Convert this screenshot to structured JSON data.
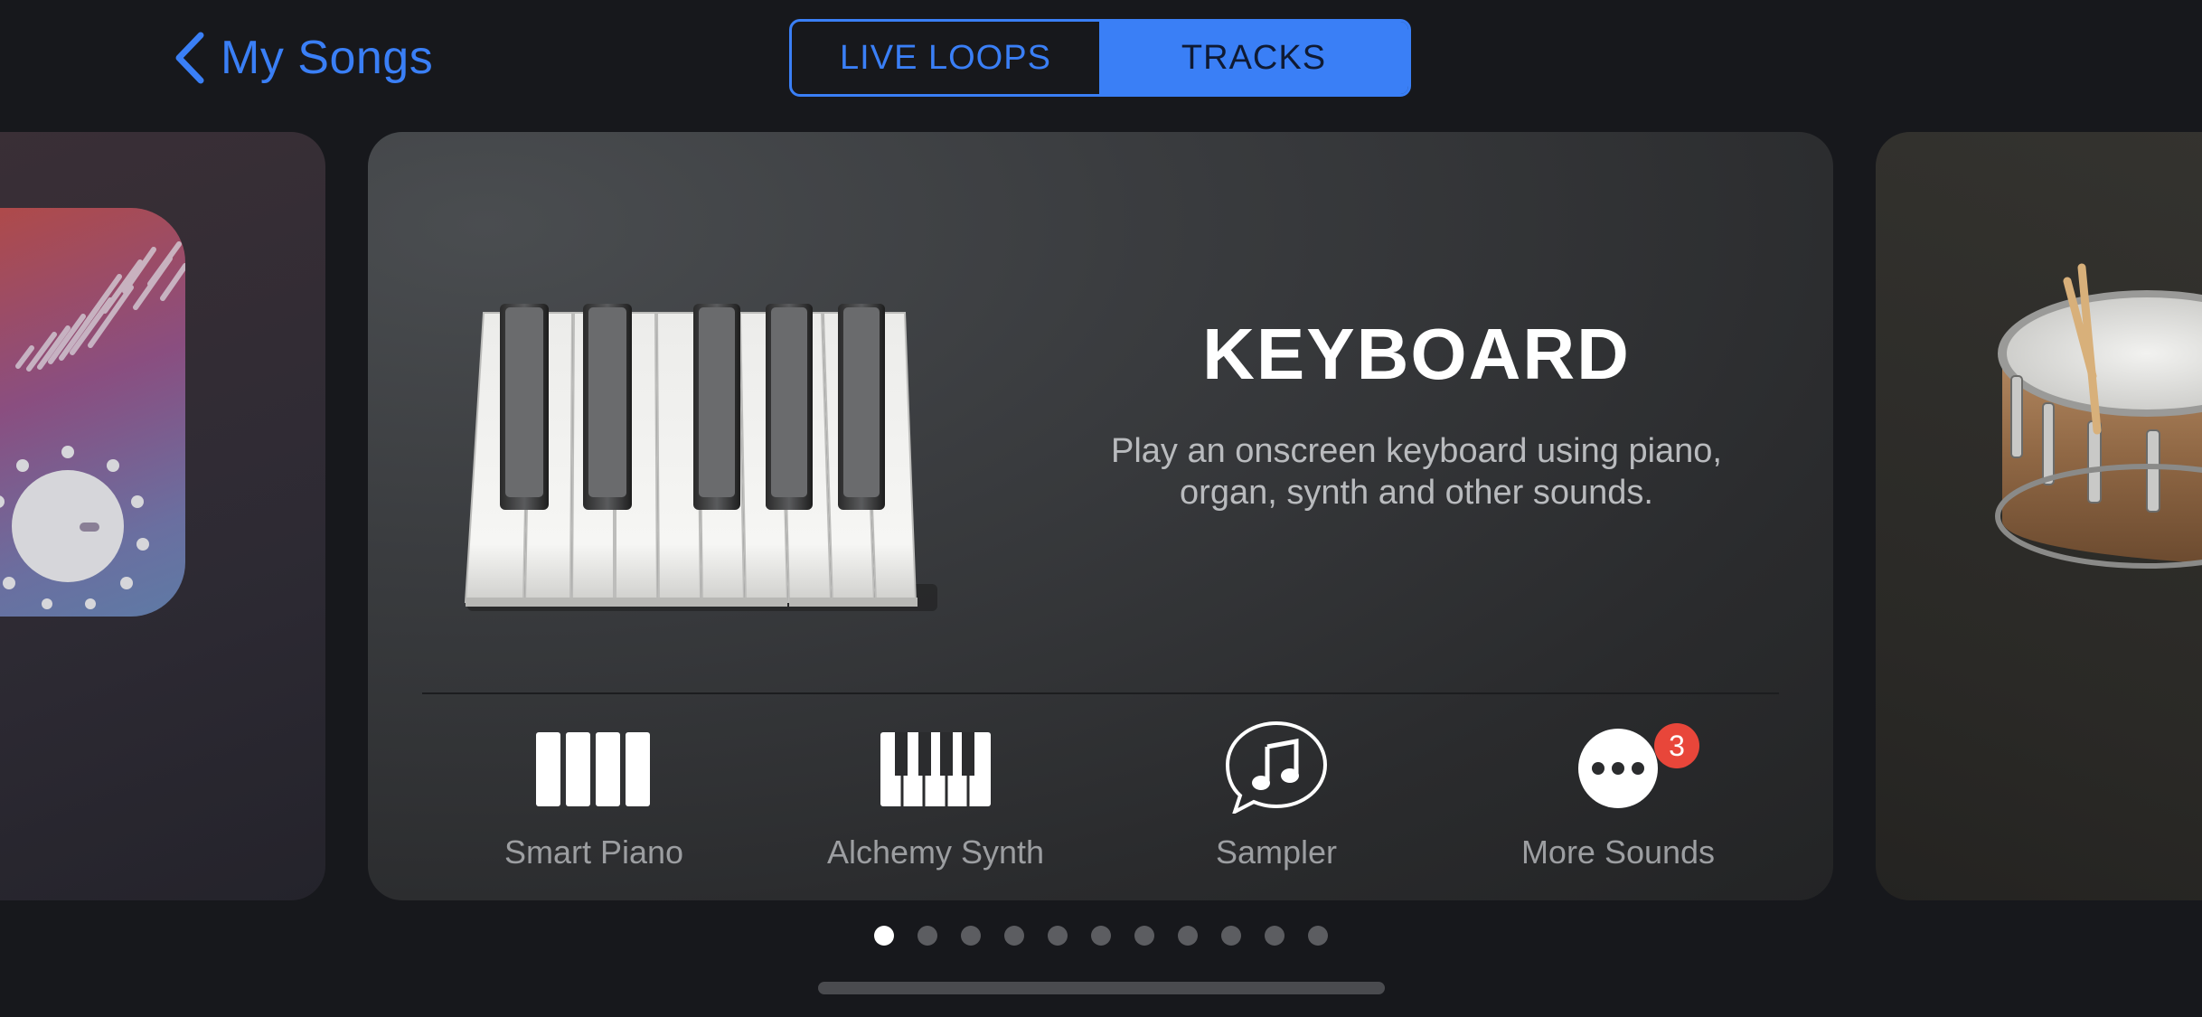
{
  "nav": {
    "back_label": "My Songs"
  },
  "segmented": {
    "options": [
      "LIVE LOOPS",
      "TRACKS"
    ],
    "selected": "TRACKS"
  },
  "instrument": {
    "title": "KEYBOARD",
    "description_line1": "Play an onscreen keyboard using piano,",
    "description_line2": "organ, synth and other sounds.",
    "options": [
      {
        "label": "Smart Piano",
        "icon": "smart-piano-icon"
      },
      {
        "label": "Alchemy Synth",
        "icon": "keys-icon"
      },
      {
        "label": "Sampler",
        "icon": "music-note-bubble-icon"
      },
      {
        "label": "More Sounds",
        "icon": "more-icon",
        "badge": "3"
      }
    ]
  },
  "pager": {
    "count": 11,
    "active_index": 0
  },
  "colors": {
    "accent": "#3a7ff6",
    "badge": "#e8463a",
    "background": "#17181c"
  }
}
